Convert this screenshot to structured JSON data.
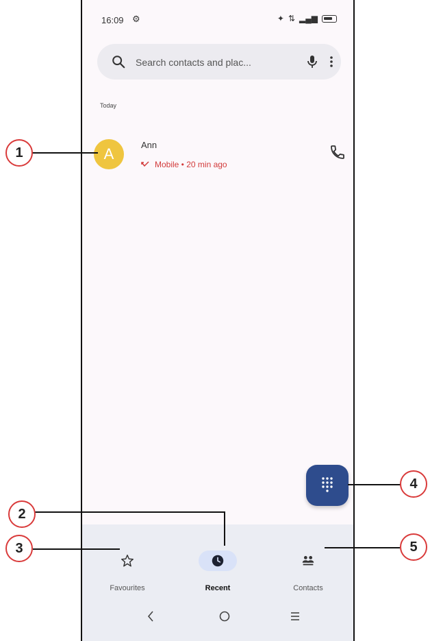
{
  "status_bar": {
    "time": "16:09"
  },
  "search": {
    "placeholder": "Search contacts and plac..."
  },
  "recents": {
    "section_header": "Today",
    "calls": [
      {
        "avatar_letter": "A",
        "name": "Ann",
        "detail": "Mobile • 20 min ago",
        "status": "missed"
      }
    ]
  },
  "bottom_nav": {
    "items": [
      {
        "label": "Favourites",
        "icon": "star-icon",
        "active": false
      },
      {
        "label": "Recent",
        "icon": "clock-icon",
        "active": true
      },
      {
        "label": "Contacts",
        "icon": "contacts-icon",
        "active": false
      }
    ]
  },
  "callouts": [
    "1",
    "2",
    "3",
    "4",
    "5"
  ],
  "colors": {
    "accent": "#2e4c8d",
    "avatar": "#efc53f",
    "missed": "#d23a3a",
    "callout_ring": "#d93a3a",
    "nav_active_pill": "#d9e2f8"
  }
}
